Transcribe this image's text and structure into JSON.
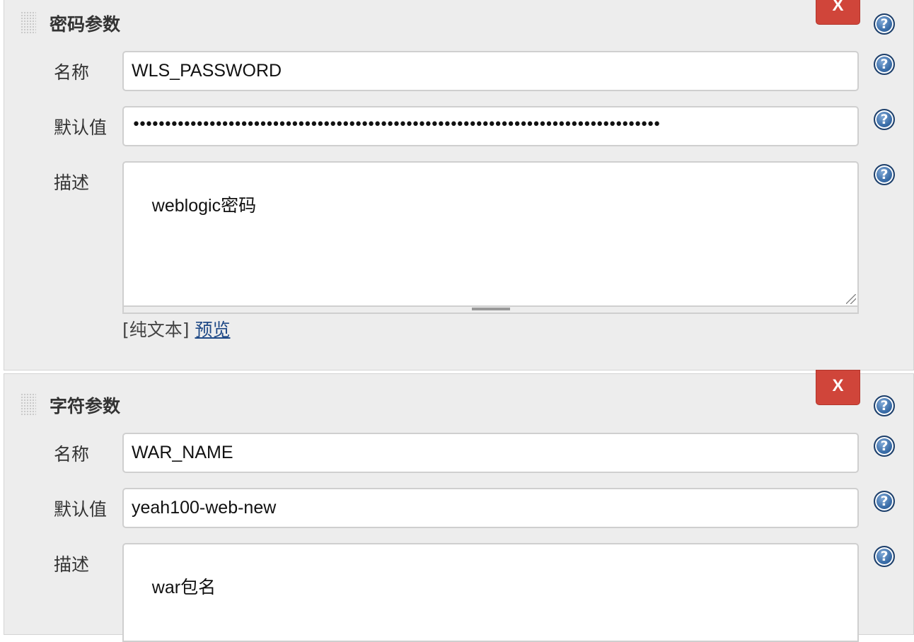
{
  "delete_label": "X",
  "help_symbol": "?",
  "params": [
    {
      "title": "密码参数",
      "name_label": "名称",
      "name_value": "WLS_PASSWORD",
      "default_label": "默认值",
      "default_value": "•••••••••••••••••••••••••••••••••••••••••••••••••••••••••••••••••••••••••••••••••••",
      "default_is_password": true,
      "description_label": "描述",
      "description_value": "weblogic密码",
      "format_plain": "[纯文本]",
      "format_preview": "预览"
    },
    {
      "title": "字符参数",
      "name_label": "名称",
      "name_value": "WAR_NAME",
      "default_label": "默认值",
      "default_value": "yeah100-web-new",
      "default_is_password": false,
      "description_label": "描述",
      "description_value": "war包名"
    }
  ]
}
